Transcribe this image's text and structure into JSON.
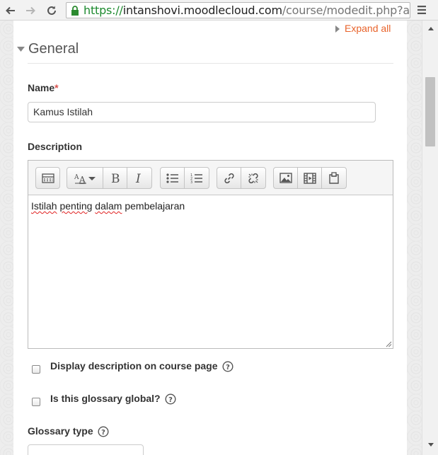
{
  "browser": {
    "url_scheme": "https://",
    "url_host": "intanshovi.moodlecloud.com",
    "url_path": "/course/modedit.php?add"
  },
  "form": {
    "expand_all_label": "Expand all",
    "section_title": "General",
    "name_label": "Name",
    "required_mark": "*",
    "name_value": "Kamus Istilah",
    "description_label": "Description",
    "description_words": [
      "Istilah",
      "penting",
      "dalam",
      "pembelajaran"
    ],
    "display_description_label": "Display description on course page",
    "display_description_checked": false,
    "glossary_global_label": "Is this glossary global?",
    "glossary_global_checked": false,
    "glossary_type_label": "Glossary type"
  },
  "toolbar_groups": [
    [
      "show-more-buttons-icon"
    ],
    [
      "font-style-icon",
      "bold-icon",
      "italic-icon"
    ],
    [
      "unordered-list-icon",
      "ordered-list-icon"
    ],
    [
      "link-icon",
      "unlink-icon"
    ],
    [
      "image-icon",
      "media-icon",
      "file-icon"
    ]
  ],
  "colors": {
    "accent_link": "#e8632b",
    "required": "#d9534f",
    "url_secure": "#1c8a2e",
    "spellcheck": "#e02020"
  }
}
